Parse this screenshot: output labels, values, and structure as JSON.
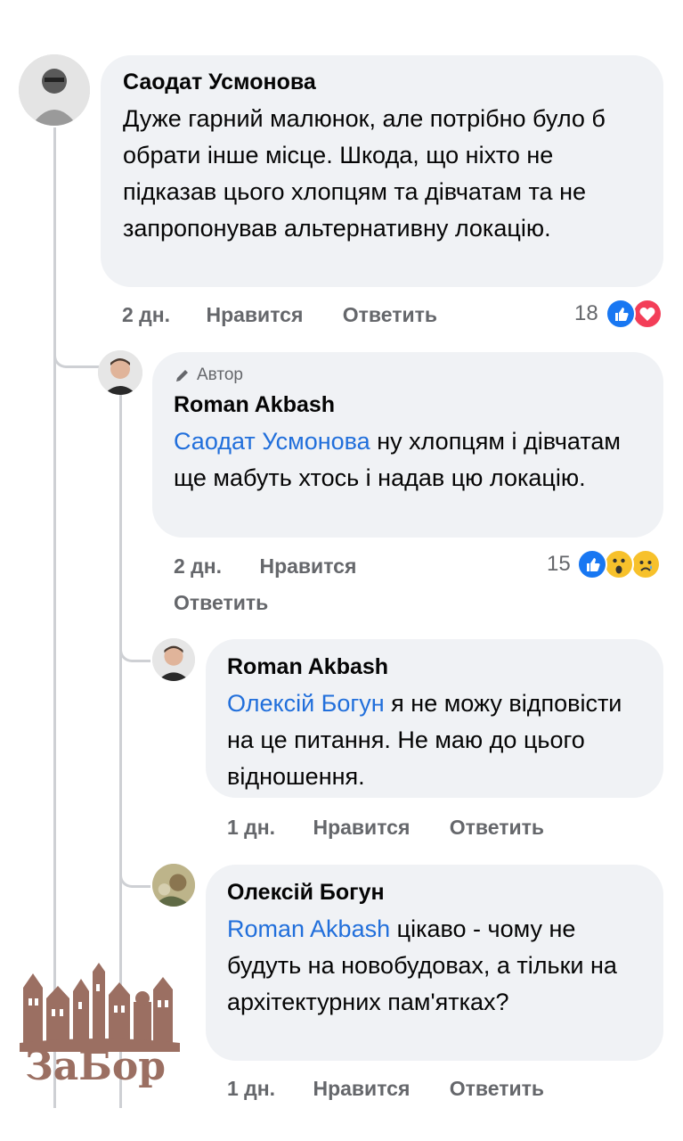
{
  "comments": [
    {
      "name": "Саодат Усмонова",
      "text": "Дуже гарний малюнок, але потрібно було б обрати інше місце. Шкода, що ніхто не підказав цього хлопцям та дівчатам та не запропонував альтернативну локацію.",
      "time": "2 дн.",
      "like": "Нравится",
      "reply": "Ответить",
      "reaction_count": "18",
      "reactions": [
        "like-icon",
        "love-icon"
      ]
    },
    {
      "badge": "Автор",
      "name": "Roman Akbash",
      "mention": "Саодат Усмонова",
      "text": " ну хлопцям і дівчатам ще мабуть хтось і надав цю локацію.",
      "time": "2 дн.",
      "like": "Нравится",
      "reply": "Ответить",
      "reaction_count": "15",
      "reactions": [
        "like-icon",
        "wow-icon",
        "sad-icon"
      ]
    },
    {
      "name": "Roman Akbash",
      "mention": "Олексій Богун",
      "text": " я не можу відповісти на це питання.  Не маю до цього відношення.",
      "time": "1 дн.",
      "like": "Нравится",
      "reply": "Ответить"
    },
    {
      "name": "Олексій Богун",
      "mention": "Roman Akbash",
      "text": " цікаво - чому не будуть на новобудовах, а тільки на архітектурних пам'ятках?",
      "time": "1 дн.",
      "like": "Нравится",
      "reply": "Ответить"
    }
  ],
  "watermark": {
    "label": "ЗаБор",
    "color": "#9b6f62"
  },
  "colors": {
    "bubble": "#f0f2f5",
    "mention": "#216fdb",
    "meta": "#65676b",
    "like": "#1877f2",
    "love": "#f33e58"
  }
}
